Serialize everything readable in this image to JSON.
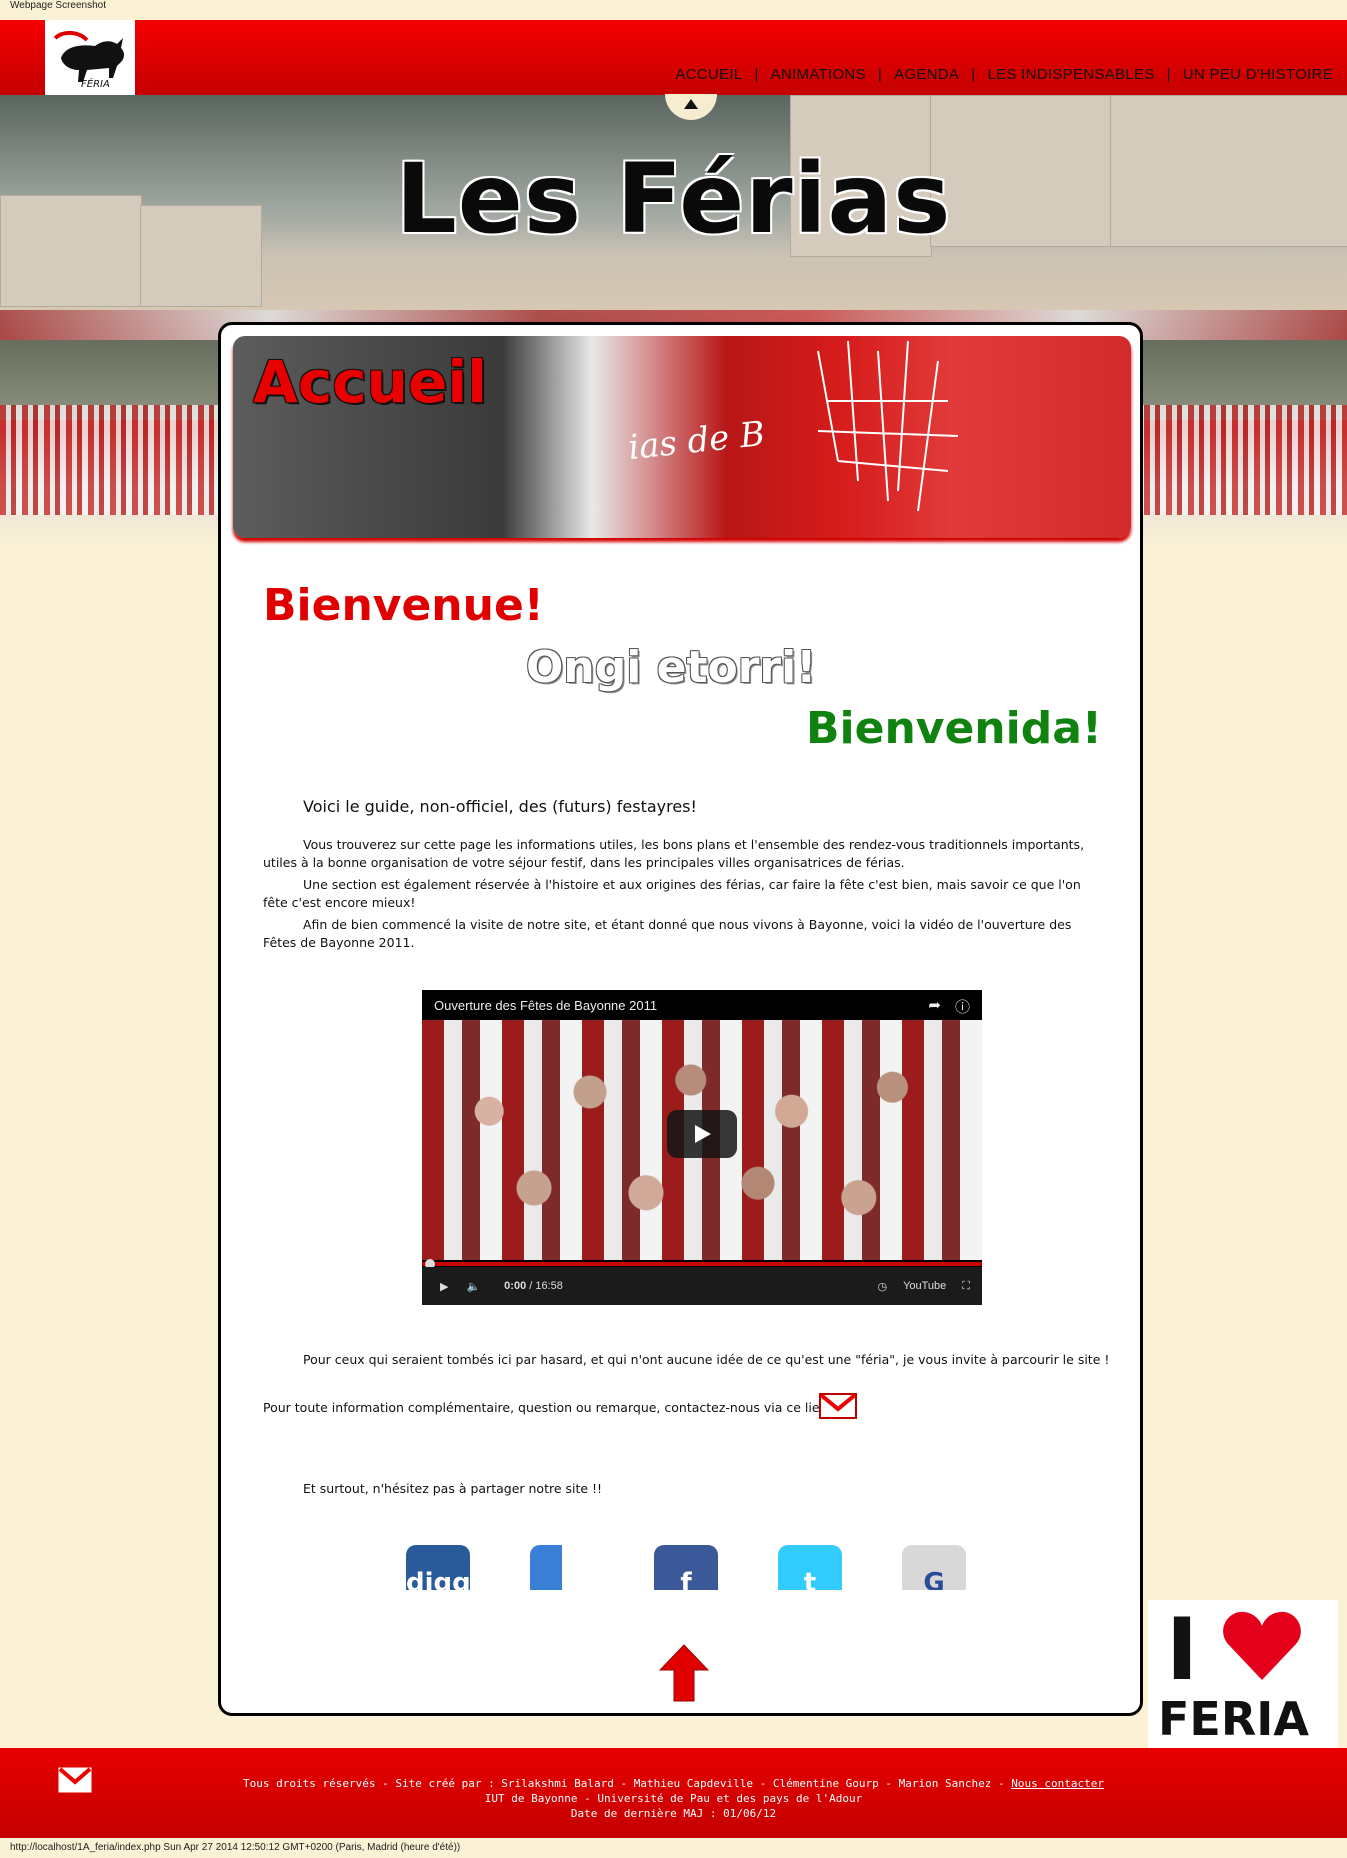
{
  "page_caption": "Webpage Screenshot",
  "nav": {
    "items": [
      "ACCUEIL",
      "ANIMATIONS",
      "AGENDA",
      "LES INDISPENSABLES",
      "UN PEU D'HISTOIRE"
    ],
    "separator": "|"
  },
  "logo": {
    "text": "FÉRIA"
  },
  "hero": {
    "title": "Les Férias"
  },
  "banner": {
    "title": "Accueil",
    "lace_text": "ias de B"
  },
  "greetings": {
    "fr": "Bienvenue!",
    "eu": "Ongi etorri!",
    "es": "Bienvenida!"
  },
  "intro": {
    "lead": "Voici le guide, non-officiel, des (futurs) festayres!",
    "p1": "Vous trouverez sur cette page les informations utiles, les bons plans et l'ensemble des rendez-vous traditionnels importants, utiles à la bonne organisation de votre séjour festif, dans les principales villes organisatrices de férias.",
    "p2": "Une section est également réservée à l'histoire et aux origines des férias, car faire la fête c'est bien, mais savoir ce que l'on fête c'est encore mieux!",
    "p3": "Afin de bien commencé la visite de notre site, et étant donné que nous vivons à Bayonne, voici la vidéo de l'ouverture des Fêtes de Bayonne 2011."
  },
  "video": {
    "title": "Ouverture des Fêtes de Bayonne 2011",
    "current_time": "0:00",
    "duration": "16:58",
    "brand": "YouTube",
    "progress": 0
  },
  "outro": {
    "n1": "Pour ceux qui seraient tombés ici par hasard, et qui n'ont aucune idée de ce qu'est une \"féria\", je vous invite à parcourir le site !",
    "n2": "Pour toute information complémentaire, question ou remarque, contactez-nous via ce lien :",
    "n3": "Et surtout, n'hésitez pas à partager notre site !!"
  },
  "share": [
    {
      "name": "digg",
      "label": "digg",
      "color": "#2a5a9a"
    },
    {
      "name": "delicious",
      "label": "",
      "color": "#3a7fd6"
    },
    {
      "name": "facebook",
      "label": "f",
      "color": "#3b5998"
    },
    {
      "name": "twitter",
      "label": "t",
      "color": "#33ccff"
    },
    {
      "name": "google",
      "label": "G",
      "color": "#d8d8d8"
    }
  ],
  "badge": {
    "i": "I",
    "word": "FERIA"
  },
  "footer": {
    "line1_prefix": "Tous droits réservés - Site créé par : Srilakshmi Balard - Mathieu Capdeville - Clémentine Gourp - Marion Sanchez - ",
    "contact_link": "Nous contacter",
    "line2": "IUT de Bayonne - Université de Pau et des pays de l'Adour",
    "line3": "Date de dernière MAJ : 01/06/12"
  },
  "status_bar": "http://localhost/1A_feria/index.php Sun Apr 27 2014 12:50:12 GMT+0200 (Paris, Madrid (heure d'été))",
  "colors": {
    "brand_red": "#e00000",
    "green": "#108210",
    "cream": "#fbf1d4"
  }
}
